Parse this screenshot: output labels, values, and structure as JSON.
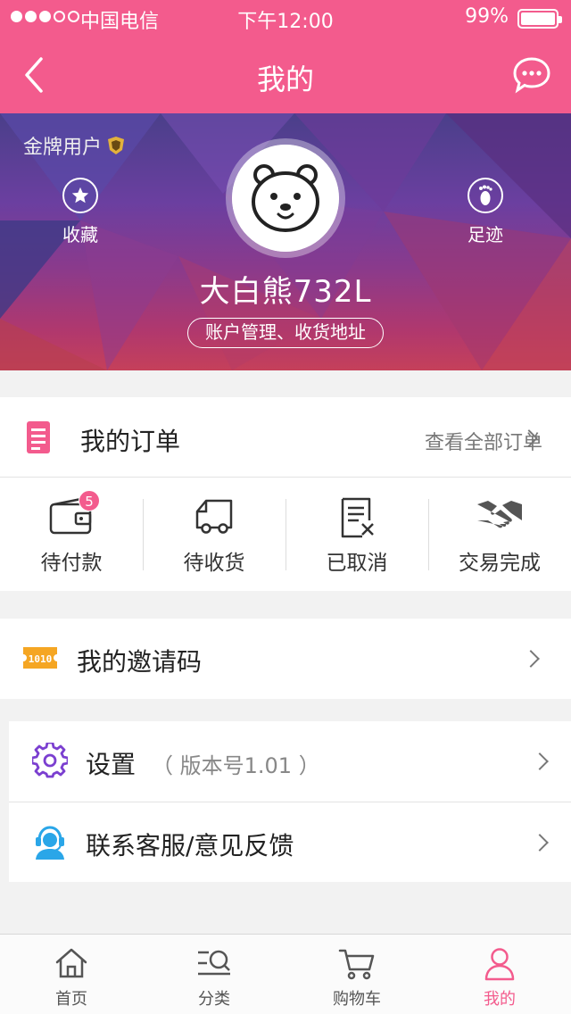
{
  "status_bar": {
    "carrier": "中国电信",
    "time": "下午12:00",
    "battery": "99%"
  },
  "nav": {
    "title": "我的",
    "back_icon": "chevron-left-icon",
    "chat_icon": "chat-bubble-icon"
  },
  "hero": {
    "member_level": "金牌用户",
    "favorites_label": "收藏",
    "footprints_label": "足迹",
    "username": "大白熊732L",
    "account_button": "账户管理、收货地址"
  },
  "orders": {
    "title": "我的订单",
    "view_all": "查看全部订单",
    "items": [
      {
        "label": "待付款",
        "badge": "5",
        "icon": "wallet-icon"
      },
      {
        "label": "待收货",
        "icon": "delivery-truck-icon"
      },
      {
        "label": "已取消",
        "icon": "cancelled-document-icon"
      },
      {
        "label": "交易完成",
        "icon": "handshake-icon"
      }
    ]
  },
  "invite": {
    "label": "我的邀请码",
    "icon": "ticket-icon"
  },
  "settings": {
    "label": "设置",
    "version": "（ 版本号1.01 ）",
    "icon": "gear-icon"
  },
  "support": {
    "label": "联系客服/意见反馈",
    "icon": "customer-service-icon"
  },
  "tabbar": {
    "items": [
      {
        "label": "首页",
        "icon": "home-icon"
      },
      {
        "label": "分类",
        "icon": "category-search-icon"
      },
      {
        "label": "购物车",
        "icon": "cart-icon"
      },
      {
        "label": "我的",
        "icon": "user-icon",
        "active": true
      }
    ]
  },
  "colors": {
    "accent": "#f35b8d",
    "invite_orange": "#f5a623",
    "settings_purple": "#7b3fd0",
    "support_blue": "#2aa6e8"
  }
}
